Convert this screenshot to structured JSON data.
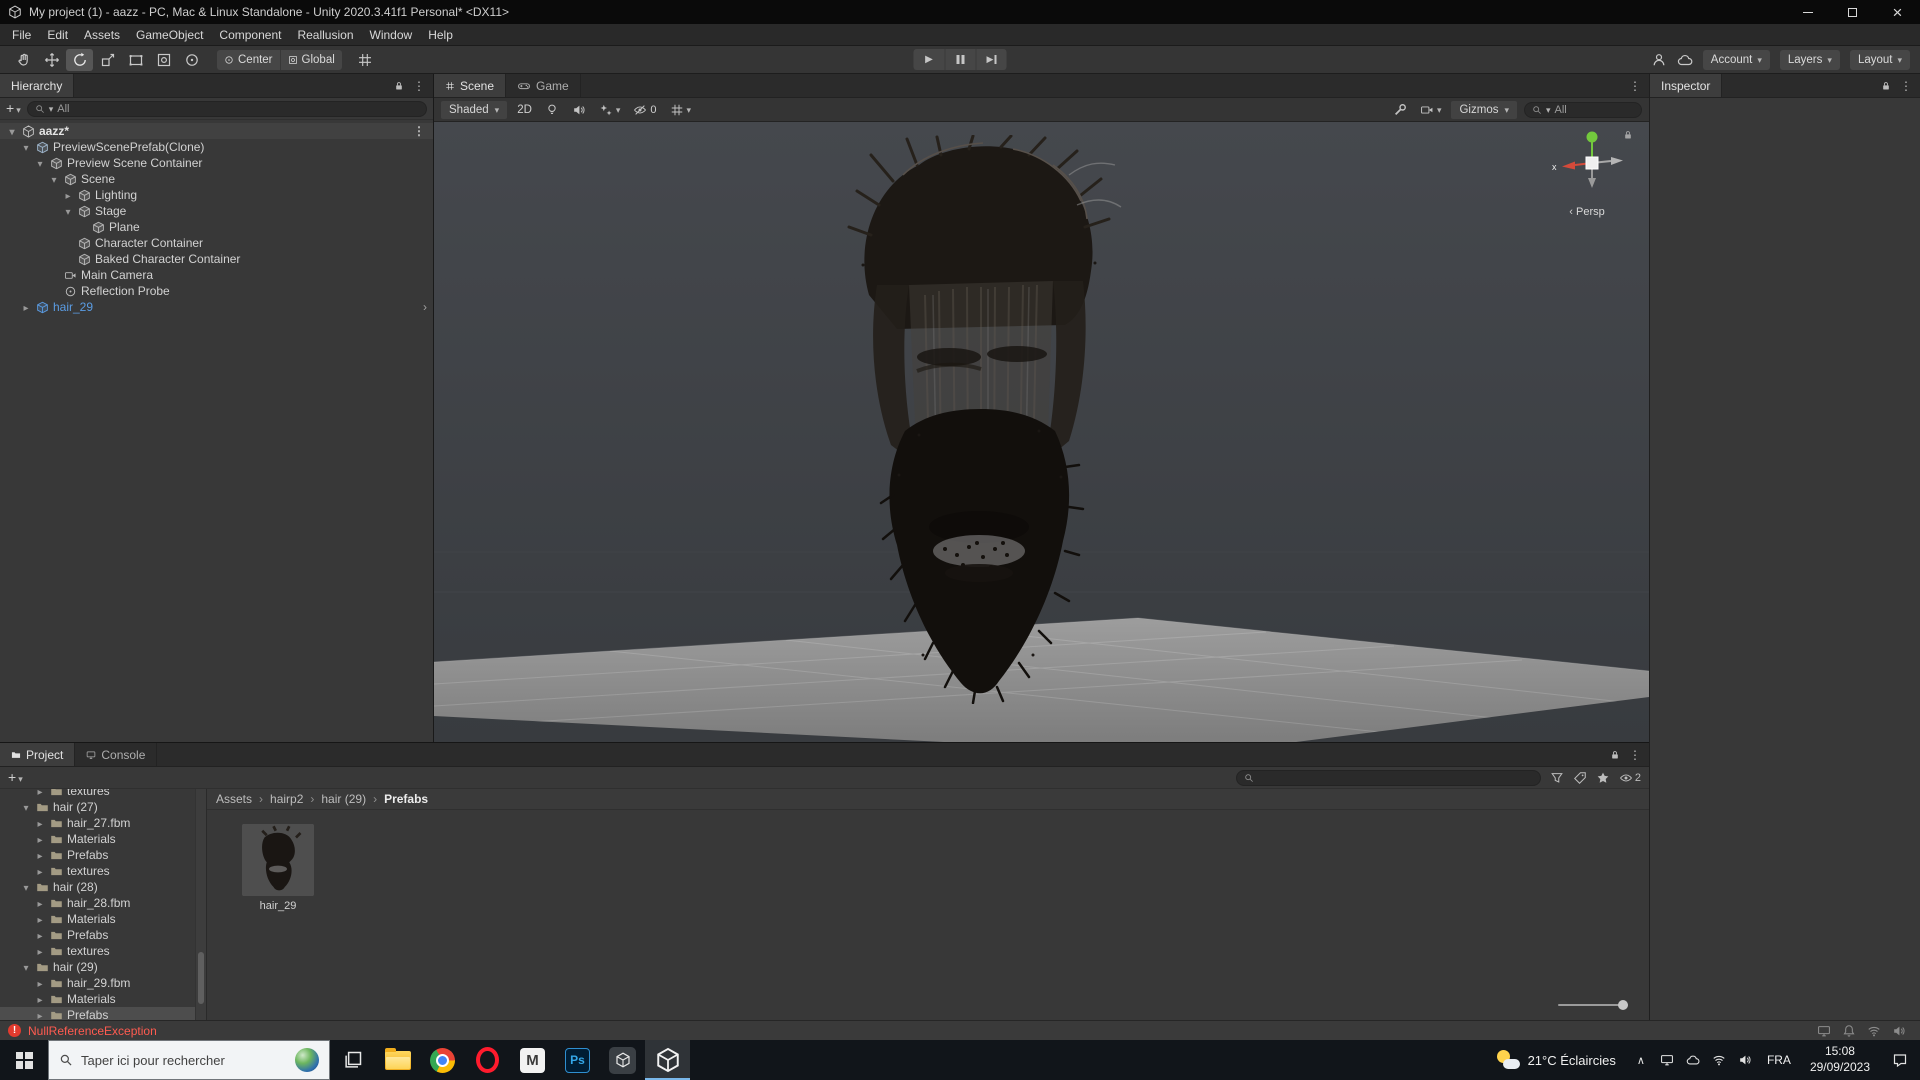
{
  "window": {
    "title": "My project (1) - aazz - PC, Mac & Linux Standalone - Unity 2020.3.41f1 Personal* <DX11>"
  },
  "menu": {
    "items": [
      "File",
      "Edit",
      "Assets",
      "GameObject",
      "Component",
      "Reallusion",
      "Window",
      "Help"
    ]
  },
  "toolbar": {
    "pivot": "Center",
    "space": "Global",
    "account": "Account",
    "layers": "Layers",
    "layout": "Layout"
  },
  "hierarchy": {
    "tab": "Hierarchy",
    "search": "All",
    "scene": "aazz*",
    "items": [
      {
        "label": "PreviewScenePrefab(Clone)"
      },
      {
        "label": "Preview Scene Container"
      },
      {
        "label": "Scene"
      },
      {
        "label": "Lighting"
      },
      {
        "label": "Stage"
      },
      {
        "label": "Plane"
      },
      {
        "label": "Character Container"
      },
      {
        "label": "Baked Character Container"
      },
      {
        "label": "Main Camera"
      },
      {
        "label": "Reflection Probe"
      },
      {
        "label": "hair_29"
      }
    ]
  },
  "scene": {
    "tab_scene": "Scene",
    "tab_game": "Game",
    "shading": "Shaded",
    "two_d": "2D",
    "hidden_count": "0",
    "gizmos": "Gizmos",
    "search": "All",
    "persp": "Persp",
    "axis_x": "x"
  },
  "inspector": {
    "tab": "Inspector"
  },
  "project": {
    "tab_project": "Project",
    "tab_console": "Console",
    "hidden_count": "2",
    "breadcrumb": [
      "Assets",
      "hairp2",
      "hair (29)",
      "Prefabs"
    ],
    "tree": [
      {
        "label": "textures"
      },
      {
        "label": "hair (27)"
      },
      {
        "label": "hair_27.fbm"
      },
      {
        "label": "Materials"
      },
      {
        "label": "Prefabs"
      },
      {
        "label": "textures"
      },
      {
        "label": "hair (28)"
      },
      {
        "label": "hair_28.fbm"
      },
      {
        "label": "Materials"
      },
      {
        "label": "Prefabs"
      },
      {
        "label": "textures"
      },
      {
        "label": "hair (29)"
      },
      {
        "label": "hair_29.fbm"
      },
      {
        "label": "Materials"
      },
      {
        "label": "Prefabs"
      }
    ],
    "asset": {
      "name": "hair_29"
    }
  },
  "status": {
    "error": "NullReferenceException"
  },
  "taskbar": {
    "search_placeholder": "Taper ici pour rechercher",
    "weather": "21°C Éclaircies",
    "language": "FRA",
    "time": "15:08",
    "date": "29/09/2023",
    "ps_label": "Ps",
    "m_label": "M"
  },
  "colors": {
    "prefab_text": "#5b9ce3",
    "error_text": "#ff5b50"
  }
}
